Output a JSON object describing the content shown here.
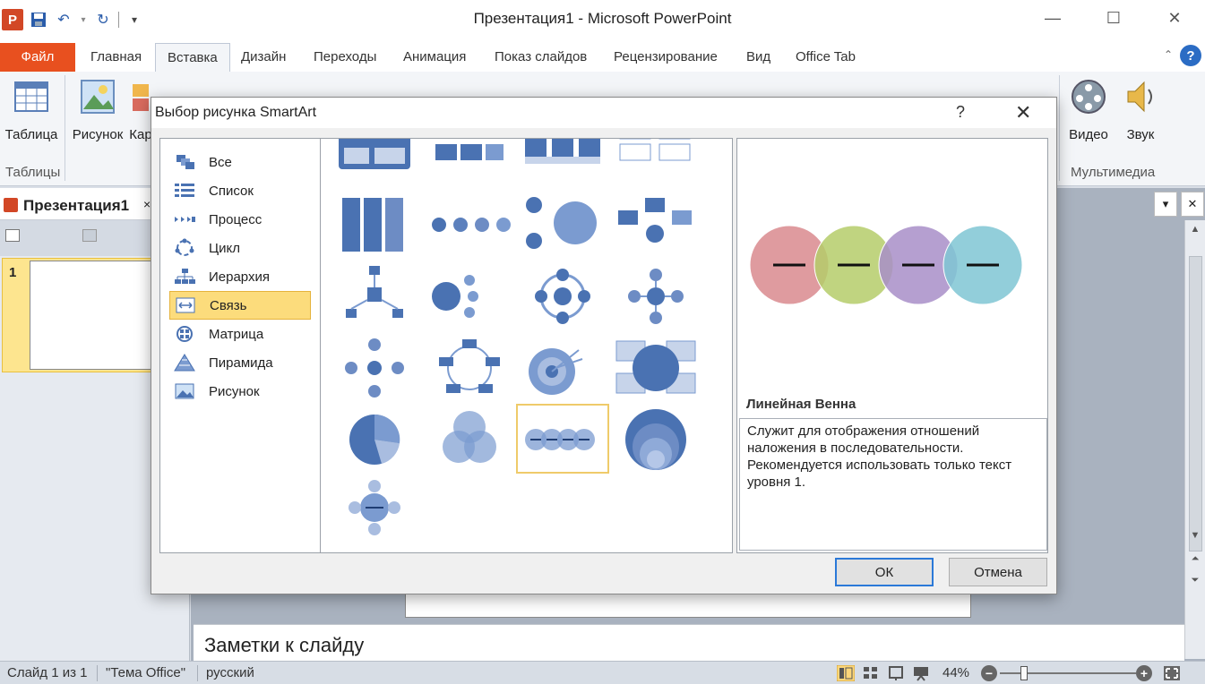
{
  "window": {
    "title": "Презентация1 - Microsoft PowerPoint",
    "app_icon_letter": "P"
  },
  "tabs": [
    {
      "label": "Файл"
    },
    {
      "label": "Главная"
    },
    {
      "label": "Вставка"
    },
    {
      "label": "Дизайн"
    },
    {
      "label": "Переходы"
    },
    {
      "label": "Анимация"
    },
    {
      "label": "Показ слайдов"
    },
    {
      "label": "Рецензирование"
    },
    {
      "label": "Вид"
    },
    {
      "label": "Office Tab"
    }
  ],
  "ribbon": {
    "table_label": "Таблица",
    "picture_label": "Рисунок",
    "clipart_label_partial": "Кар",
    "video_label": "Видео",
    "sound_label": "Звук",
    "group_tables": "Таблицы",
    "group_media": "Мультимедиа",
    "help": "?"
  },
  "left_panel": {
    "doc_tab_title": "Презентация1",
    "close": "×",
    "slide_number": "1"
  },
  "notes": {
    "placeholder": "Заметки к слайду"
  },
  "status_bar": {
    "slide_info": "Слайд 1 из 1",
    "theme": "\"Тема Office\"",
    "language": "русский",
    "zoom": "44%",
    "zoom_fraction": 0.18
  },
  "dialog": {
    "title": "Выбор рисунка SmartArt",
    "help": "?",
    "categories": [
      {
        "label": "Все"
      },
      {
        "label": "Список"
      },
      {
        "label": "Процесс"
      },
      {
        "label": "Цикл"
      },
      {
        "label": "Иерархия"
      },
      {
        "label": "Связь"
      },
      {
        "label": "Матрица"
      },
      {
        "label": "Пирамида"
      },
      {
        "label": "Рисунок"
      }
    ],
    "selected_category": "Связь",
    "preview_title": "Линейная Венна",
    "preview_description": "Служит для отображения отношений наложения в последовательности. Рекомендуется использовать только текст уровня 1.",
    "ok_label": "ОК",
    "cancel_label": "Отмена",
    "colors": {
      "venn1": "#d98a8e",
      "venn2": "#b5cc6a",
      "venn3": "#a88ec8",
      "venn4": "#7fc6d4",
      "accent": "#4a72b2"
    }
  }
}
